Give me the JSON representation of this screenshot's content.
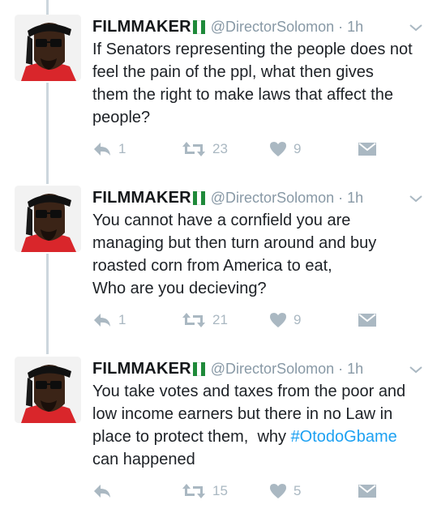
{
  "author": {
    "name": "FILMMAKER",
    "handle": "@DirectorSolomon",
    "separator": "·",
    "flag_colors": [
      "#1f8a3a",
      "#ffffff",
      "#1f8a3a"
    ]
  },
  "tweets": [
    {
      "time": "1h",
      "lines": [
        "If Senators representing the people does not",
        "feel the pain of the ppl, what then gives",
        "them the right to make laws that affect the",
        "people?"
      ],
      "reply_count": "1",
      "retweet_count": "23",
      "like_count": "9"
    },
    {
      "time": "1h",
      "lines": [
        "You cannot have a cornfield you are",
        "managing but then turn around and buy",
        "roasted corn from America to eat,",
        "Who are you decieving?"
      ],
      "reply_count": "1",
      "retweet_count": "21",
      "like_count": "9"
    },
    {
      "time": "1h",
      "lines": [
        "You take votes and taxes from the poor and",
        "low income earners but there in no Law in",
        "place to protect them,  why "
      ],
      "hashtag": "#OtodoGbame",
      "last_line": "can happened",
      "reply_count": "",
      "retweet_count": "15",
      "like_count": "5"
    }
  ],
  "colors": {
    "text": "#1d2126",
    "muted": "#8899a6",
    "action_icon": "#aab8c2",
    "hashtag": "#1da1f2",
    "thread_line": "#ccd6dd"
  },
  "icons": [
    "reply-icon",
    "retweet-icon",
    "heart-icon",
    "direct-message-icon",
    "chevron-down-icon"
  ]
}
